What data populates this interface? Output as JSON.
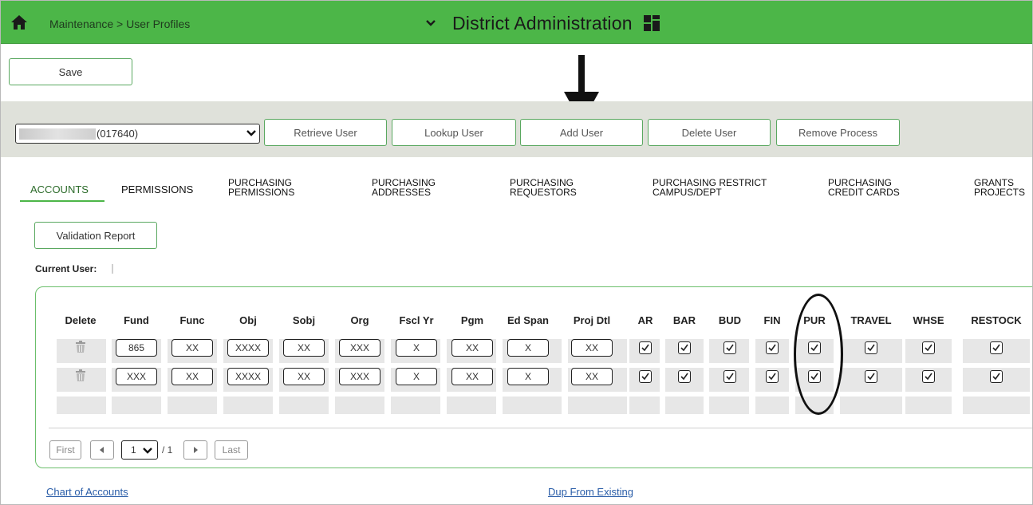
{
  "topbar": {
    "breadcrumb": "Maintenance > User Profiles",
    "app_title": "District Administration",
    "color": "#4cb648"
  },
  "toolbar": {
    "save_label": "Save"
  },
  "user_bar": {
    "selected_user": "(017640)",
    "buttons": [
      "Retrieve User",
      "Lookup User",
      "Add User",
      "Delete User",
      "Remove Process"
    ]
  },
  "tabs": [
    {
      "label": "ACCOUNTS",
      "active": true
    },
    {
      "label": "PERMISSIONS"
    },
    {
      "label": "PURCHASING\nPERMISSIONS"
    },
    {
      "label": "PURCHASING\nADDRESSES"
    },
    {
      "label": "PURCHASING\nREQUESTORS"
    },
    {
      "label": "PURCHASING RESTRICT\nCAMPUS/DEPT"
    },
    {
      "label": "PURCHASING\nCREDIT CARDS"
    },
    {
      "label": "GRANTS\nPROJECTS"
    }
  ],
  "validation_report_label": "Validation Report",
  "current_user_label": "Current User:",
  "table": {
    "headers": [
      "Delete",
      "Fund",
      "Func",
      "Obj",
      "Sobj",
      "Org",
      "Fscl Yr",
      "Pgm",
      "Ed Span",
      "Proj Dtl",
      "AR",
      "BAR",
      "BUD",
      "FIN",
      "PUR",
      "TRAVEL",
      "WHSE",
      "RESTOCK"
    ],
    "rows": [
      {
        "fund": "865",
        "func": "XX",
        "obj": "XXXX",
        "sobj": "XX",
        "org": "XXX",
        "fscl_yr": "X",
        "pgm": "XX",
        "ed_span": "X",
        "proj_dtl": "XX"
      },
      {
        "fund": "XXX",
        "func": "XX",
        "obj": "XXXX",
        "sobj": "XX",
        "org": "XXX",
        "fscl_yr": "X",
        "pgm": "XX",
        "ed_span": "X",
        "proj_dtl": "XX"
      }
    ]
  },
  "pager": {
    "first": "First",
    "last": "Last",
    "page": "1",
    "of": "/ 1"
  },
  "links": {
    "chart_of_accounts": "Chart of Accounts",
    "dup_from_existing": "Dup From Existing"
  }
}
